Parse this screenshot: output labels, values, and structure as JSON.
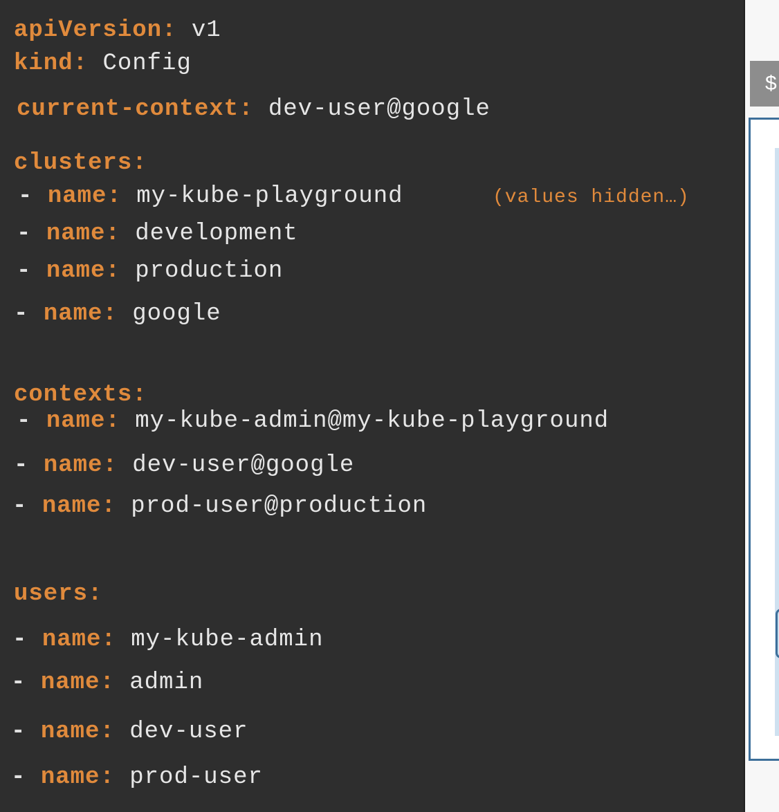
{
  "yaml": {
    "api_version_key": "apiVersion",
    "api_version_value": "v1",
    "kind_key": "kind",
    "kind_value": "Config",
    "current_context_key": "current-context",
    "current_context_value": "dev-user@google",
    "name_key": "name",
    "dash": "-",
    "colon": ":",
    "clusters": {
      "key": "clusters",
      "items": [
        "my-kube-playground",
        "development",
        "production",
        "google"
      ],
      "note": "(values hidden…)"
    },
    "contexts": {
      "key": "contexts",
      "items": [
        "my-kube-admin@my-kube-playground",
        "dev-user@google",
        "prod-user@production"
      ]
    },
    "users": {
      "key": "users",
      "items": [
        "my-kube-admin",
        "admin",
        "dev-user",
        "prod-user"
      ]
    }
  },
  "side_panel": {
    "prompt_symbol": "$"
  }
}
